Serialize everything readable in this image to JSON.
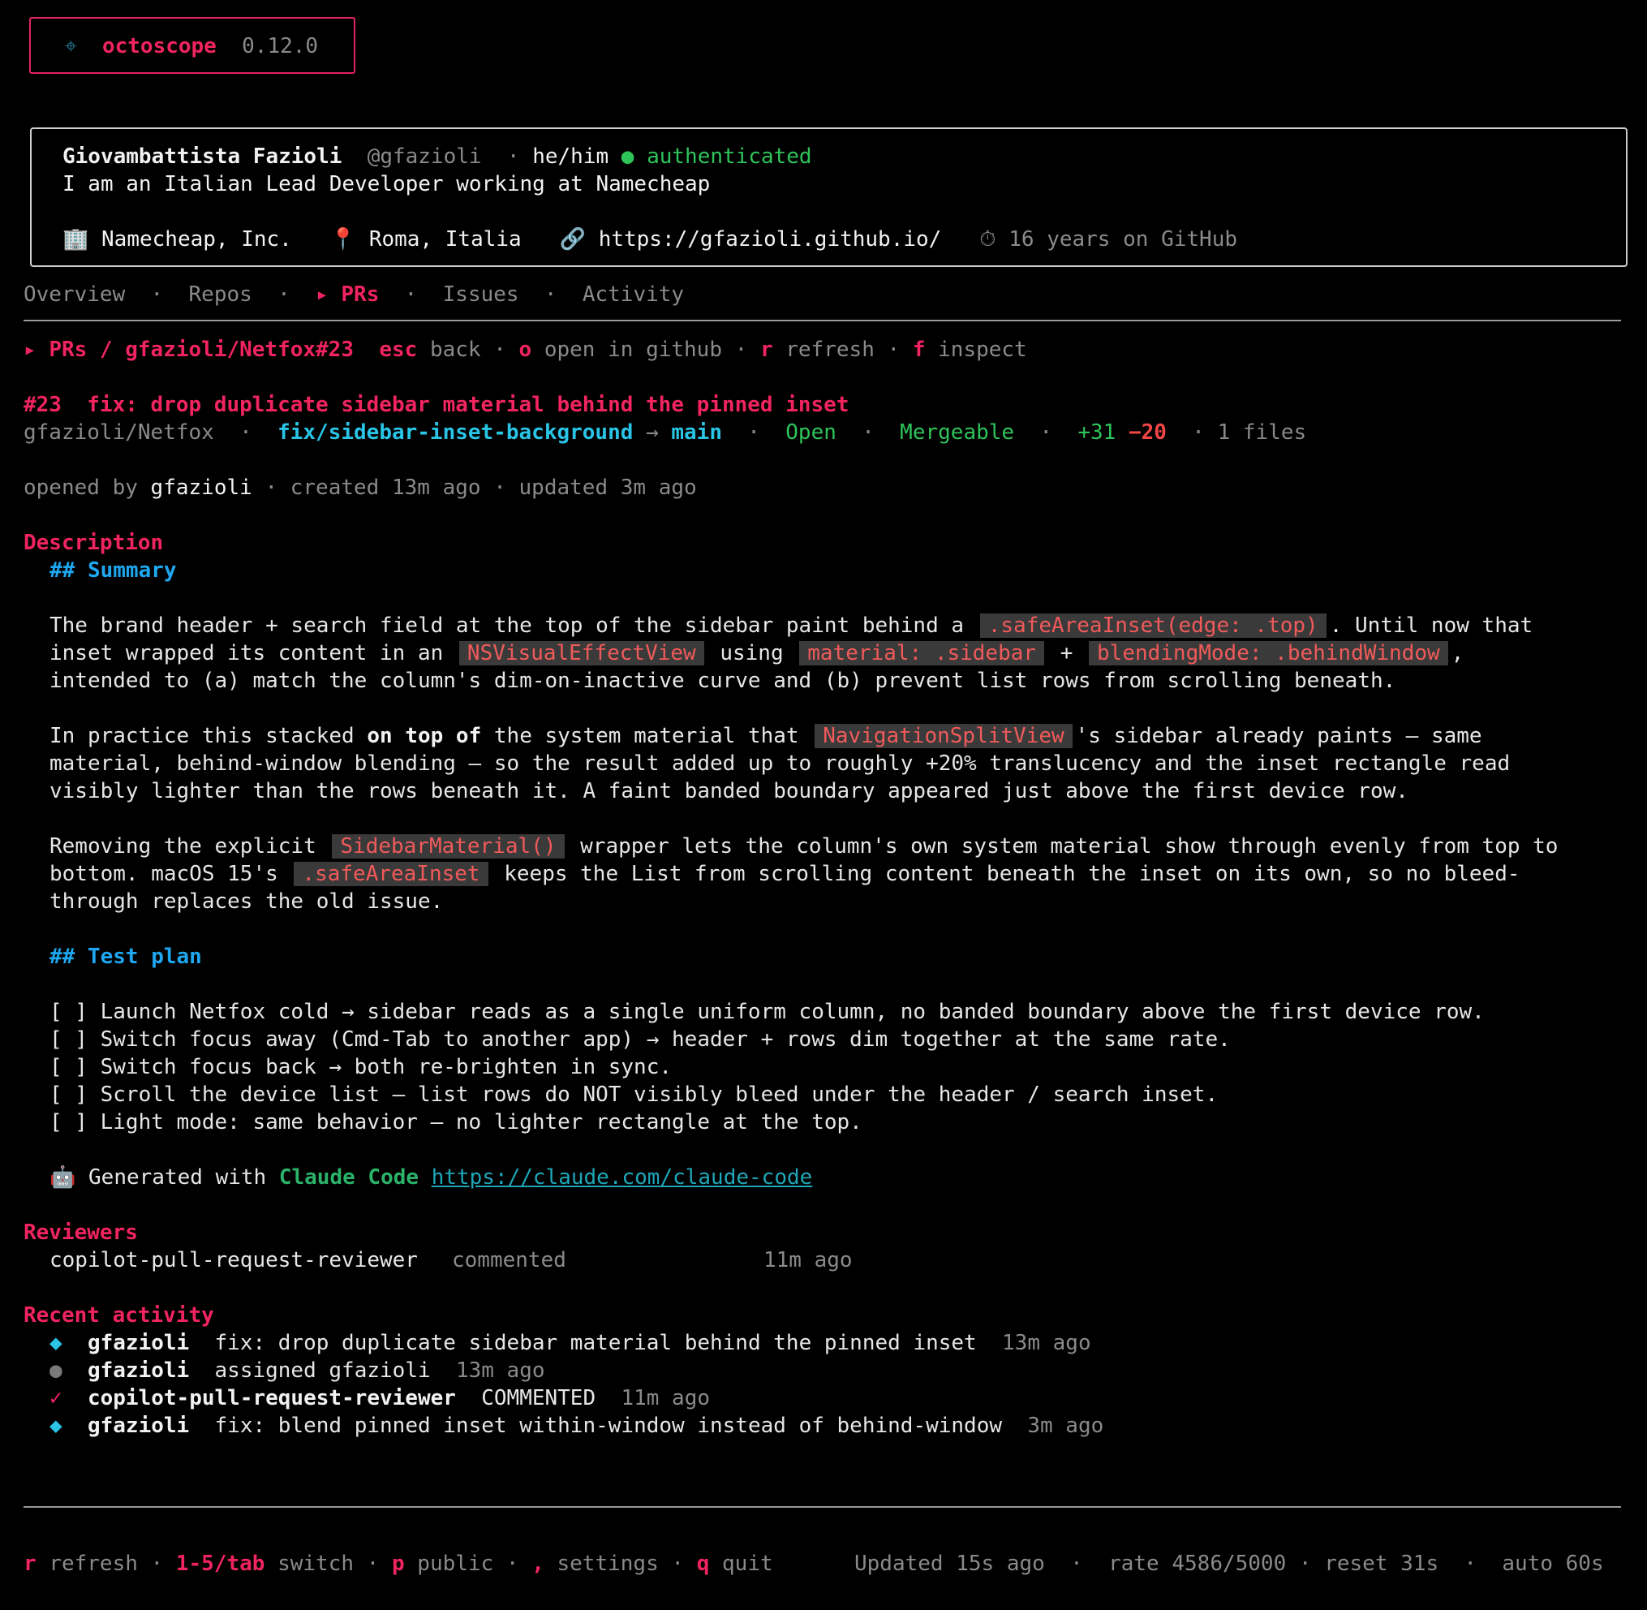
{
  "brand": {
    "icon": "crosshair-icon",
    "name": "octoscope",
    "version": "0.12.0"
  },
  "profile": {
    "name": "Giovambattista Fazioli",
    "handle": "@gfazioli",
    "pronouns": "he/him",
    "auth_dot": "●",
    "auth_label": "authenticated",
    "bio": "I am an Italian Lead Developer working at Namecheap",
    "company_icon": "🏢",
    "company": "Namecheap, Inc.",
    "location_icon": "📍",
    "location": "Roma, Italia",
    "link_icon": "🔗",
    "website": "https://gfazioli.github.io/",
    "age_icon": "⏱",
    "age": "16 years on GitHub"
  },
  "tabs": {
    "sep": "·",
    "active_marker": "▸",
    "items": [
      "Overview",
      "Repos",
      "PRs",
      "Issues",
      "Activity"
    ]
  },
  "breadcrumb": {
    "marker": "▸",
    "path": "PRs / gfazioli/Netfox#23",
    "keys": [
      {
        "key": "esc",
        "label": "back"
      },
      {
        "key": "o",
        "label": "open in github"
      },
      {
        "key": "r",
        "label": "refresh"
      },
      {
        "key": "f",
        "label": "inspect"
      }
    ]
  },
  "pr": {
    "number": "#23",
    "title": "fix: drop duplicate sidebar material behind the pinned inset",
    "repo": "gfazioli/Netfox",
    "head": "fix/sidebar-inset-background",
    "arrow": "→",
    "base": "main",
    "state": "Open",
    "mergeable": "Mergeable",
    "additions": "+31",
    "deletions": "−20",
    "files": "1 files",
    "opened_by_label": "opened by",
    "author": "gfazioli",
    "created": "created 13m ago",
    "updated": "updated 3m ago"
  },
  "description": {
    "heading": "Description",
    "summary_heading": "## Summary",
    "p1": {
      "a": "The brand header + search field at the top of the sidebar paint behind a",
      "code1": ".safeAreaInset(edge: .top)",
      "b": ". Until now that",
      "c": "inset wrapped its content in an",
      "code2": "NSVisualEffectView",
      "d": "using",
      "code3": "material: .sidebar",
      "e": "+",
      "code4": "blendingMode: .behindWindow",
      "f": ",",
      "g": "intended to (a) match the column's dim-on-inactive curve and (b) prevent list rows from scrolling beneath."
    },
    "p2": {
      "a": "In practice this stacked",
      "bold": "on top of",
      "b": "the system material that",
      "code1": "NavigationSplitView",
      "c": "'s sidebar already paints — same",
      "line2": "material, behind-window blending — so the result added up to roughly +20% translucency and the inset rectangle read",
      "line3": "visibly lighter than the rows beneath it. A faint banded boundary appeared just above the first device row."
    },
    "p3": {
      "a": "Removing the explicit",
      "code1": "SidebarMaterial()",
      "b": "wrapper lets the column's own system material show through evenly from top to",
      "c": "bottom. macOS 15's",
      "code2": ".safeAreaInset",
      "d": "keeps the List from scrolling content beneath the inset on its own, so no bleed-",
      "line3": "through replaces the old issue."
    },
    "test_heading": "## Test plan",
    "checklist": [
      "[ ] Launch Netfox cold → sidebar reads as a single uniform column, no banded boundary above the first device row.",
      "[ ] Switch focus away (Cmd-Tab to another app) → header + rows dim together at the same rate.",
      "[ ] Switch focus back → both re-brighten in sync.",
      "[ ] Scroll the device list — list rows do NOT visibly bleed under the header / search inset.",
      "[ ] Light mode: same behavior — no lighter rectangle at the top."
    ],
    "generated_icon": "🤖",
    "generated_prefix": "Generated with",
    "generated_tool": "Claude Code",
    "generated_link": "https://claude.com/claude-code"
  },
  "reviewers": {
    "heading": "Reviewers",
    "items": [
      {
        "name": "copilot-pull-request-reviewer",
        "state": "commented",
        "time": "11m ago"
      }
    ]
  },
  "activity": {
    "heading": "Recent activity",
    "items": [
      {
        "icon": "◆",
        "icon_name": "commit-diamond-icon",
        "actor": "gfazioli",
        "text": "fix: drop duplicate sidebar material behind the pinned inset",
        "time": "13m ago"
      },
      {
        "icon": "●",
        "icon_name": "event-dot-icon",
        "actor": "gfazioli",
        "text": "assigned gfazioli",
        "time": "13m ago"
      },
      {
        "icon": "✓",
        "icon_name": "review-check-icon",
        "actor": "copilot-pull-request-reviewer",
        "text": "COMMENTED",
        "time": "11m ago"
      },
      {
        "icon": "◆",
        "icon_name": "commit-diamond-icon",
        "actor": "gfazioli",
        "text": "fix: blend pinned inset within-window instead of behind-window",
        "time": "3m ago"
      }
    ]
  },
  "footer": {
    "keys": [
      {
        "key": "r",
        "label": "refresh"
      },
      {
        "key": "1-5/tab",
        "label": "switch"
      },
      {
        "key": "p",
        "label": "public"
      },
      {
        "key": ",",
        "label": "settings"
      },
      {
        "key": "q",
        "label": "quit"
      }
    ],
    "updated": "Updated 15s ago",
    "rate": "rate 4586/5000",
    "reset": "reset 31s",
    "auto": "auto 60s"
  },
  "colors": {
    "accent": "#f0245f",
    "cyan": "#29c4e6",
    "green": "#2fc45a",
    "red": "#f04646",
    "code_bg": "#3a3a3a"
  }
}
